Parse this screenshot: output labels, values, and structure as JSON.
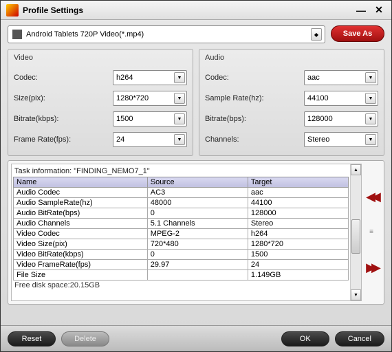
{
  "window": {
    "title": "Profile Settings"
  },
  "profile": {
    "selected": "Android Tablets 720P Video(*.mp4)",
    "save_as": "Save As"
  },
  "video": {
    "legend": "Video",
    "codec_label": "Codec:",
    "codec": "h264",
    "size_label": "Size(pix):",
    "size": "1280*720",
    "bitrate_label": "Bitrate(kbps):",
    "bitrate": "1500",
    "framerate_label": "Frame Rate(fps):",
    "framerate": "24"
  },
  "audio": {
    "legend": "Audio",
    "codec_label": "Codec:",
    "codec": "aac",
    "samplerate_label": "Sample Rate(hz):",
    "samplerate": "44100",
    "bitrate_label": "Bitrate(bps):",
    "bitrate": "128000",
    "channels_label": "Channels:",
    "channels": "Stereo"
  },
  "task": {
    "caption_prefix": "Task information: ",
    "caption_name": "\"FINDING_NEMO7_1\"",
    "headers": {
      "name": "Name",
      "source": "Source",
      "target": "Target"
    },
    "rows": [
      {
        "name": "Audio Codec",
        "source": "AC3",
        "target": "aac"
      },
      {
        "name": "Audio SampleRate(hz)",
        "source": "48000",
        "target": "44100"
      },
      {
        "name": "Audio BitRate(bps)",
        "source": "0",
        "target": "128000"
      },
      {
        "name": "Audio Channels",
        "source": "5.1 Channels",
        "target": "Stereo"
      },
      {
        "name": "Video Codec",
        "source": "MPEG-2",
        "target": "h264"
      },
      {
        "name": "Video Size(pix)",
        "source": "720*480",
        "target": "1280*720"
      },
      {
        "name": "Video BitRate(kbps)",
        "source": "0",
        "target": "1500"
      },
      {
        "name": "Video FrameRate(fps)",
        "source": "29.97",
        "target": "24"
      },
      {
        "name": "File Size",
        "source": "",
        "target": "1.149GB"
      }
    ],
    "free_disk_label": "Free disk space:",
    "free_disk_value": "20.15GB"
  },
  "footer": {
    "reset": "Reset",
    "delete": "Delete",
    "ok": "OK",
    "cancel": "Cancel"
  }
}
